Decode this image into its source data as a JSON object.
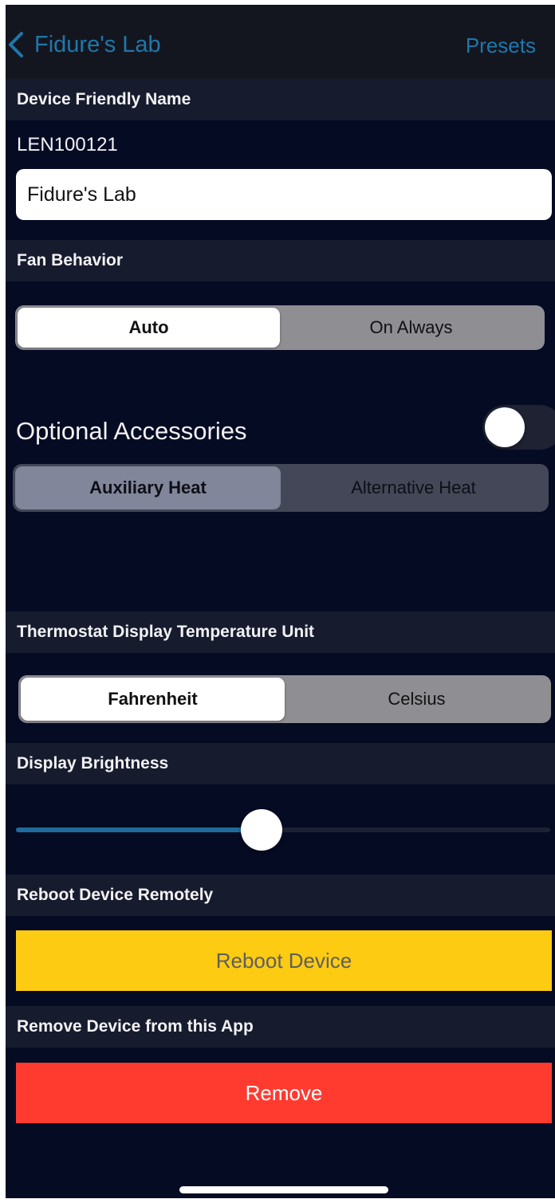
{
  "navbar": {
    "back_label": "Fidure's Lab",
    "right_action": "Presets"
  },
  "device_name": {
    "header": "Device Friendly Name",
    "device_id": "LEN100121",
    "input_value": "Fidure's Lab"
  },
  "fan": {
    "header": "Fan Behavior",
    "options": [
      "Auto",
      "On Always"
    ],
    "selected": "Auto"
  },
  "accessories": {
    "label": "Optional Accessories",
    "enabled": false,
    "options": [
      "Auxiliary Heat",
      "Alternative Heat"
    ],
    "selected": "Auxiliary Heat"
  },
  "temperature_unit": {
    "header": "Thermostat Display Temperature Unit",
    "options": [
      "Fahrenheit",
      "Celsius"
    ],
    "selected": "Fahrenheit"
  },
  "brightness": {
    "header": "Display Brightness",
    "level": 0.46
  },
  "reboot": {
    "header": "Reboot Device Remotely",
    "button_label": "Reboot Device"
  },
  "remove": {
    "header": "Remove Device from this App",
    "button_label": "Remove"
  },
  "colors": {
    "background": "#060b24",
    "accent": "#1f77ab",
    "reboot": "#fccb12",
    "remove": "#ff3b30"
  }
}
